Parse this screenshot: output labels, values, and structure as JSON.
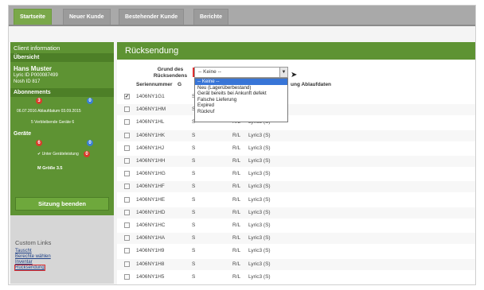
{
  "nav": {
    "tabs": [
      {
        "label": "Startseite",
        "active": true
      },
      {
        "label": "Neuer Kunde",
        "active": false
      },
      {
        "label": "Bestehender Kunde",
        "active": false
      },
      {
        "label": "Berichte",
        "active": false
      }
    ]
  },
  "sidebar": {
    "client_info": "Client information",
    "overview": "Übersicht",
    "customer_name": "Hans Muster",
    "customer_id": "Lyric ID P000087499",
    "nosh_id": "Nosh ID 817",
    "subscriptions_title": "Abonnements",
    "sub_count_red": "3",
    "sub_count_blue": "0",
    "sub_dates": "06.07.2016  Ablaufdatum  03.09.2015",
    "remaining_devices": "5  Verbleibende Geräte  6",
    "devices_title": "Geräte",
    "dev_count_red": "6",
    "dev_count_blue": "0",
    "replacement_note": "Unter Geräteleistung",
    "replacement_badge": "0",
    "size_row": "M     Größe     3.5",
    "end_session": "Sitzung beenden",
    "custom_links_title": "Custom Links",
    "links": [
      "Tauscht",
      "Berechte wählen",
      "Inventar",
      "Rücksendung"
    ]
  },
  "main": {
    "title": "Rücksendung",
    "grund_label": "Grund des Rücksendens",
    "select_value": "-- Keine --",
    "dropdown_options": [
      "-- Keine --",
      "Neu (Lagerüberbestand)",
      "Gerät bereits bei Ankunft defekt",
      "Falsche Lieferung",
      "Expired",
      "Rückruf"
    ],
    "col_serial": "Seriennummer",
    "col_g": "G",
    "col_rest": "ung  Ablaufdaten",
    "rows": [
      {
        "serial": "1406NY1G1",
        "checked": true,
        "s": "S",
        "r": "",
        "lyric": ""
      },
      {
        "serial": "1406NY1HM",
        "checked": false,
        "s": "S",
        "r": "",
        "lyric": ""
      },
      {
        "serial": "1406NY1HL",
        "checked": false,
        "s": "S",
        "r": "R/L",
        "lyric": "Lyric3 (S)"
      },
      {
        "serial": "1406NY1HK",
        "checked": false,
        "s": "S",
        "r": "R/L",
        "lyric": "Lyric3 (S)"
      },
      {
        "serial": "1406NY1HJ",
        "checked": false,
        "s": "S",
        "r": "R/L",
        "lyric": "Lyric3 (S)"
      },
      {
        "serial": "1406NY1HH",
        "checked": false,
        "s": "S",
        "r": "R/L",
        "lyric": "Lyric3 (S)"
      },
      {
        "serial": "1406NY1HG",
        "checked": false,
        "s": "S",
        "r": "R/L",
        "lyric": "Lyric3 (S)"
      },
      {
        "serial": "1406NY1HF",
        "checked": false,
        "s": "S",
        "r": "R/L",
        "lyric": "Lyric3 (S)"
      },
      {
        "serial": "1406NY1HE",
        "checked": false,
        "s": "S",
        "r": "R/L",
        "lyric": "Lyric3 (S)"
      },
      {
        "serial": "1406NY1HD",
        "checked": false,
        "s": "S",
        "r": "R/L",
        "lyric": "Lyric3 (S)"
      },
      {
        "serial": "1406NY1HC",
        "checked": false,
        "s": "S",
        "r": "R/L",
        "lyric": "Lyric3 (S)"
      },
      {
        "serial": "1406NY1HA",
        "checked": false,
        "s": "S",
        "r": "R/L",
        "lyric": "Lyric3 (S)"
      },
      {
        "serial": "1406NY1H9",
        "checked": false,
        "s": "S",
        "r": "R/L",
        "lyric": "Lyric3 (S)"
      },
      {
        "serial": "1406NY1H8",
        "checked": false,
        "s": "S",
        "r": "R/L",
        "lyric": "Lyric3 (S)"
      },
      {
        "serial": "1406NY1H5",
        "checked": false,
        "s": "S",
        "r": "R/L",
        "lyric": "Lyric3 (S)"
      }
    ]
  }
}
